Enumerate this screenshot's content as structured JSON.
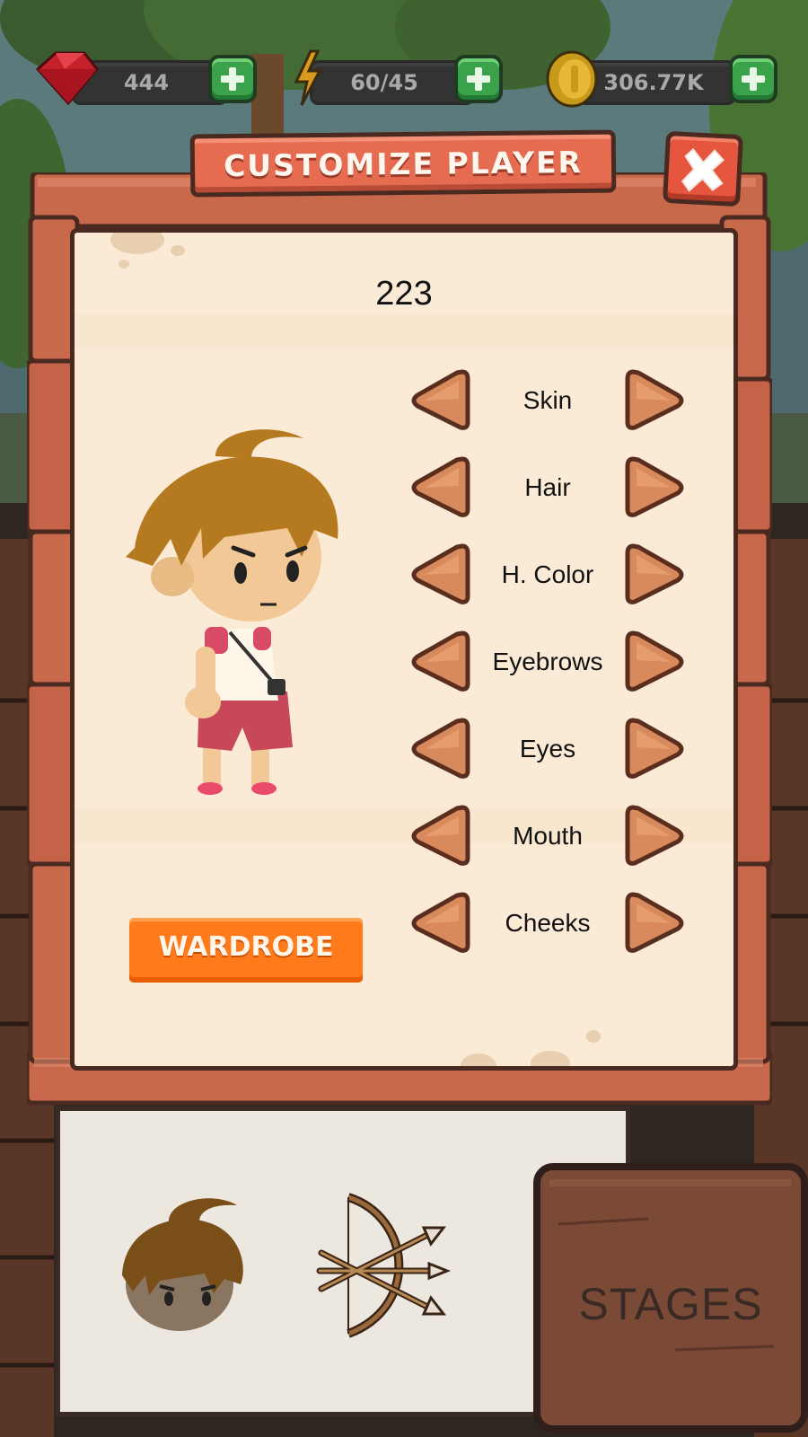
{
  "currency": {
    "gems": "444",
    "energy": "60/45",
    "coins": "306.77K"
  },
  "dialog": {
    "title": "CUSTOMIZE PLAYER",
    "score": "223",
    "options": [
      {
        "label": "Skin"
      },
      {
        "label": "Hair"
      },
      {
        "label": "H. Color"
      },
      {
        "label": "Eyebrows"
      },
      {
        "label": "Eyes"
      },
      {
        "label": "Mouth"
      },
      {
        "label": "Cheeks"
      }
    ],
    "wardrobe_label": "WARDROBE"
  },
  "bottom": {
    "stages_label": "STAGES"
  },
  "colors": {
    "wood": "#c8694c",
    "panel": "#fbebd6",
    "arrow": "#d98a5c",
    "plus": "#3aa24a",
    "wardrobe": "#ff7a1a"
  },
  "icons": [
    "gem-icon",
    "lightning-icon",
    "coin-icon",
    "close-icon",
    "bow-arrows-icon"
  ]
}
